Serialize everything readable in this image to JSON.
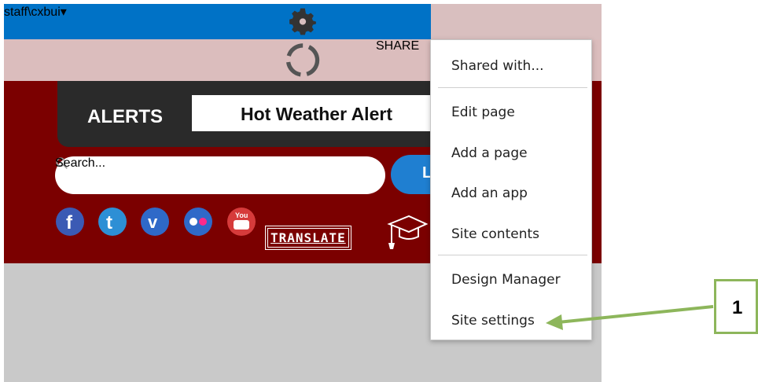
{
  "suite_bar": {
    "user": "staff\\cxbui",
    "user_caret": "▾"
  },
  "ribbon": {
    "share_label": "SHARE"
  },
  "brand": {
    "alert_label": "ALERTS",
    "alert_text": "Hot Weather Alert",
    "search_placeholder": "Search...",
    "go_button_letter": "L",
    "translate_label": "TRANSLATE"
  },
  "social_icons": [
    "facebook-icon",
    "twitter-icon",
    "vimeo-icon",
    "flickr-icon",
    "youtube-icon"
  ],
  "settings_menu": {
    "items": [
      "Shared with...",
      "Edit page",
      "Add a page",
      "Add an app",
      "Site contents",
      "Design Manager",
      "Site settings"
    ]
  },
  "callout": {
    "number": "1"
  },
  "colors": {
    "suite_blue": "#0072c6",
    "brand_red": "#7b0000",
    "callout_green": "#8db65b"
  }
}
